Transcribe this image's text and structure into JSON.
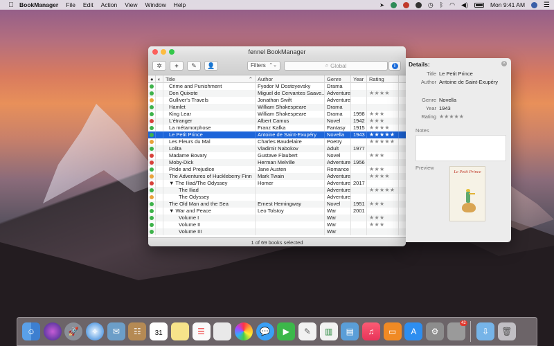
{
  "menubar": {
    "app_name": "BookManager",
    "items": [
      "File",
      "Edit",
      "Action",
      "View",
      "Window",
      "Help"
    ],
    "clock": "Mon 9:41 AM"
  },
  "window": {
    "title": "fennel BookManager",
    "filters_label": "Filters",
    "search_placeholder": "Global",
    "status": "1 of 69 books selected",
    "columns": [
      "Title",
      "Author",
      "Genre",
      "Year",
      "Rating"
    ],
    "rows": [
      {
        "dot": "g",
        "bdot": true,
        "title": "Crime and Punishment",
        "author": "Fyodor M Dostoyevsky",
        "genre": "Drama",
        "year": "",
        "rating": ""
      },
      {
        "dot": "g",
        "bdot": false,
        "title": "Don Quixote",
        "author": "Miguel de Cervantes Saave...",
        "genre": "Adventure",
        "year": "",
        "rating": "★★★★"
      },
      {
        "dot": "y",
        "bdot": true,
        "title": "Gulliver's Travels",
        "author": "Jonathan Swift",
        "genre": "Adventure",
        "year": "",
        "rating": ""
      },
      {
        "dot": "g",
        "bdot": true,
        "title": "Hamlet",
        "author": "William Shakespeare",
        "genre": "Drama",
        "year": "",
        "rating": ""
      },
      {
        "dot": "g",
        "bdot": false,
        "title": "King Lear",
        "author": "William Shakespeare",
        "genre": "Drama",
        "year": "1998",
        "rating": "★★★"
      },
      {
        "dot": "r",
        "bdot": false,
        "title": "L'étranger",
        "author": "Albert Camus",
        "genre": "Novel",
        "year": "1942",
        "rating": "★★★"
      },
      {
        "dot": "g",
        "bdot": false,
        "title": "La métamorphose",
        "author": "Franz Kafka",
        "genre": "Fantasy",
        "year": "1915",
        "rating": "★★★★"
      },
      {
        "dot": "g",
        "bdot": false,
        "title": "Le Petit Prince",
        "author": "Antoine de Saint-Exupéry",
        "genre": "Novella",
        "year": "1943",
        "rating": "★★★★★",
        "selected": true
      },
      {
        "dot": "y",
        "bdot": false,
        "title": "Les Fleurs du Mal",
        "author": "Charles Baudelaire",
        "genre": "Poetry",
        "year": "",
        "rating": "★★★★★"
      },
      {
        "dot": "g",
        "bdot": true,
        "title": "Lolita",
        "author": "Vladimir Nabokov",
        "genre": "Adult",
        "year": "1977",
        "rating": ""
      },
      {
        "dot": "r",
        "bdot": false,
        "title": "Madame Bovary",
        "author": "Gustave Flaubert",
        "genre": "Novel",
        "year": "",
        "rating": "★★★"
      },
      {
        "dot": "r",
        "bdot": false,
        "title": "Moby-Dick",
        "author": "Herman Melville",
        "genre": "Adventure",
        "year": "1956",
        "rating": ""
      },
      {
        "dot": "g",
        "bdot": false,
        "title": "Pride and Prejudice",
        "author": "Jane Austen",
        "genre": "Romance",
        "year": "",
        "rating": "★★★"
      },
      {
        "dot": "y",
        "bdot": false,
        "title": "The Adventures of Huckleberry Finn",
        "author": "Mark Twain",
        "genre": "Adventure",
        "year": "",
        "rating": "★★★★"
      },
      {
        "dot": "r",
        "bdot": true,
        "title": "▼ The Iliad/The Odyssey",
        "author": "Homer",
        "genre": "Adventure",
        "year": "2017",
        "rating": ""
      },
      {
        "dot": "g",
        "bdot": false,
        "title": "The Iliad",
        "author": "",
        "genre": "Adventure",
        "year": "",
        "rating": "★★★★★",
        "indent": true
      },
      {
        "dot": "y",
        "bdot": true,
        "title": "The Odyssey",
        "author": "",
        "genre": "Adventure",
        "year": "",
        "rating": "",
        "indent": true
      },
      {
        "dot": "g",
        "bdot": false,
        "title": "The Old Man and the Sea",
        "author": "Ernest Hemingway",
        "genre": "Novel",
        "year": "1951",
        "rating": "★★★"
      },
      {
        "dot": "g",
        "bdot": false,
        "title": "▼ War and Peace",
        "author": "Leo Tolstoy",
        "genre": "War",
        "year": "2001",
        "rating": ""
      },
      {
        "dot": "g",
        "bdot": false,
        "title": "Volume I",
        "author": "",
        "genre": "War",
        "year": "",
        "rating": "★★★",
        "indent": true
      },
      {
        "dot": "g",
        "bdot": false,
        "title": "Volume II",
        "author": "",
        "genre": "War",
        "year": "",
        "rating": "★★★",
        "indent": true
      },
      {
        "dot": "g",
        "bdot": true,
        "title": "Volume III",
        "author": "",
        "genre": "War",
        "year": "",
        "rating": "",
        "indent": true
      }
    ]
  },
  "details": {
    "header": "Details:",
    "title_label": "Title",
    "title_value": "Le Petit Prince",
    "author_label": "Author",
    "author_value": "Antoine de Saint-Exupéry",
    "genre_label": "Genre",
    "genre_value": "Novella",
    "year_label": "Year",
    "year_value": "1943",
    "rating_label": "Rating",
    "rating_value": "★★★★★",
    "notes_label": "Notes",
    "preview_label": "Preview",
    "cover_title": "Le Petit Prince"
  },
  "dock": {
    "calendar_day": "31",
    "badge": "42"
  }
}
